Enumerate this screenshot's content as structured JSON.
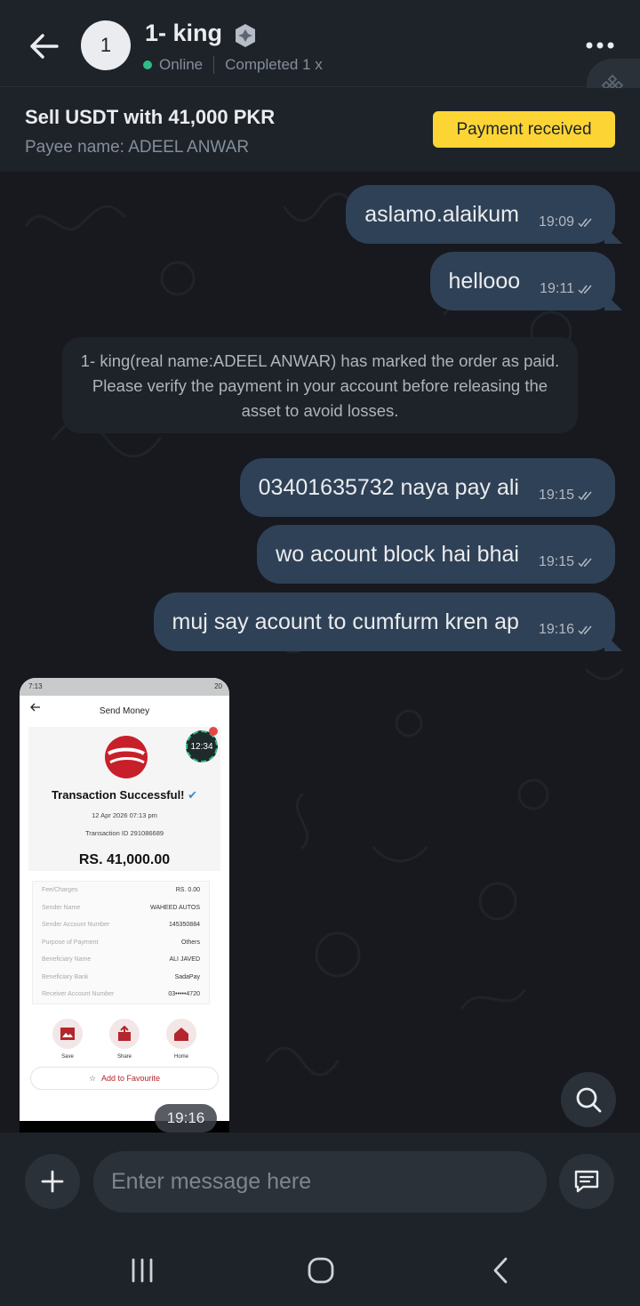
{
  "header": {
    "avatar_initial": "1",
    "username": "1- king",
    "online_status": "Online",
    "completed_label": "Completed 1 x"
  },
  "order": {
    "title": "Sell USDT with 41,000 PKR",
    "payee": "Payee name: ADEEL ANWAR",
    "status_badge": "Payment received"
  },
  "messages": [
    {
      "text": "aslamo.alaikum",
      "time": "19:09"
    },
    {
      "text": "hellooo",
      "time": "19:11"
    },
    {
      "text": "03401635732 naya pay ali",
      "time": "19:15"
    },
    {
      "text": "wo acount block hai bhai",
      "time": "19:15"
    },
    {
      "text": "muj say acount to cumfurm kren ap",
      "time": "19:16"
    }
  ],
  "system_note": "1- king(real name:ADEEL ANWAR) has marked the order as paid. Please verify the payment in your account before releasing the asset to avoid losses.",
  "image_message": {
    "time": "19:16",
    "status_time": "7:13",
    "status_right": "20",
    "screen_title": "Send Money",
    "timer": "12:34",
    "heading": "Transaction Successful!",
    "date": "12 Apr 2026 07:13 pm",
    "transaction_id": "Transaction ID 291086689",
    "amount": "RS. 41,000.00",
    "details": [
      {
        "k": "Fee/Charges",
        "v": "RS. 0.00"
      },
      {
        "k": "Sender Name",
        "v": "WAHEED AUTOS"
      },
      {
        "k": "Sender Account Number",
        "v": "145350884"
      },
      {
        "k": "Purpose of Payment",
        "v": "Others"
      },
      {
        "k": "Beneficiary Name",
        "v": "ALI JAVED"
      },
      {
        "k": "Beneficiary Bank",
        "v": "SadaPay"
      },
      {
        "k": "Receiver Account Number",
        "v": "03•••••4720"
      }
    ],
    "actions": [
      "Save",
      "Share",
      "Home"
    ],
    "favourite": "Add to Favourite"
  },
  "input": {
    "placeholder": "Enter message here"
  },
  "colors": {
    "accent_yellow": "#fcd535",
    "bubble": "#2f4156",
    "online": "#2ebd85",
    "background": "#17191e"
  }
}
